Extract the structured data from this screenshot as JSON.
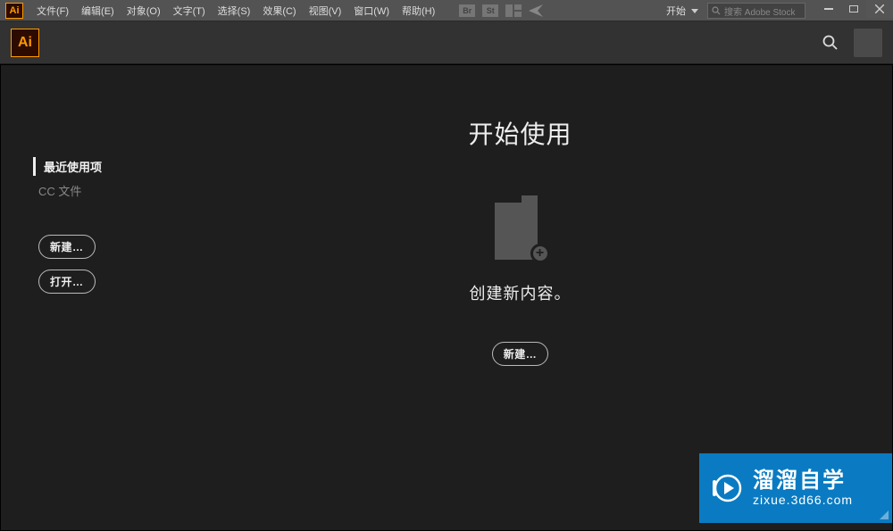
{
  "menubar": {
    "logo": "Ai",
    "items": [
      "文件(F)",
      "编辑(E)",
      "对象(O)",
      "文字(T)",
      "选择(S)",
      "效果(C)",
      "视图(V)",
      "窗口(W)",
      "帮助(H)"
    ],
    "br_label": "Br",
    "st_label": "St",
    "start_label": "开始",
    "search_placeholder": "搜索 Adobe Stock"
  },
  "toolbar": {
    "logo": "Ai"
  },
  "sidebar": {
    "recent": "最近使用项",
    "cc_files": "CC 文件",
    "new_label": "新建…",
    "open_label": "打开…"
  },
  "content": {
    "title": "开始使用",
    "subtitle": "创建新内容。",
    "new_label": "新建…",
    "plus": "+"
  },
  "watermark": {
    "title": "溜溜自学",
    "sub": "zixue.3d66.com"
  }
}
